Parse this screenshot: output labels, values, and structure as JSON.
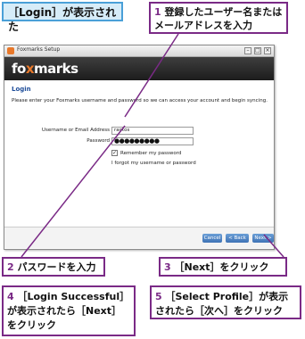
{
  "captions": {
    "screen": "［Login］が表示された",
    "step1_num": "1",
    "step1_text": " 登録したユーザー名またはメールアドレスを入力",
    "step2_num": "2",
    "step2_text": " パスワードを入力",
    "step3_num": "3",
    "step3_text": " ［Next］をクリック",
    "step4_num": "4",
    "step4_text": " ［Login Successful］が表示されたら［Next］をクリック",
    "step5_num": "5",
    "step5_text": " ［Select Profile］が表示されたら［次へ］をクリック"
  },
  "window": {
    "title": "Foxmarks Setup",
    "minimize": "–",
    "maximize": "□",
    "close": "×"
  },
  "banner": {
    "logo_part1": "fo",
    "logo_part2": "x",
    "logo_part3": "marks"
  },
  "login": {
    "heading": "Login",
    "instructions": "Please enter your Foxmarks username and password so we can access your account and begin syncing.",
    "username_label": "Username or Email Address",
    "username_value": "raotos",
    "password_label": "Password",
    "password_value": "●●●●●●●●●",
    "remember_label": "Remember my password",
    "remember_check": "✓",
    "forgot_link": "I forgot my username or password"
  },
  "buttons": {
    "cancel": "Cancel",
    "back": "< Back",
    "next": "Next >"
  },
  "colors": {
    "accent": "#7a2a86",
    "banner": "#1c1c1c",
    "brand_orange": "#e8782a",
    "button_blue": "#3f73b5"
  }
}
